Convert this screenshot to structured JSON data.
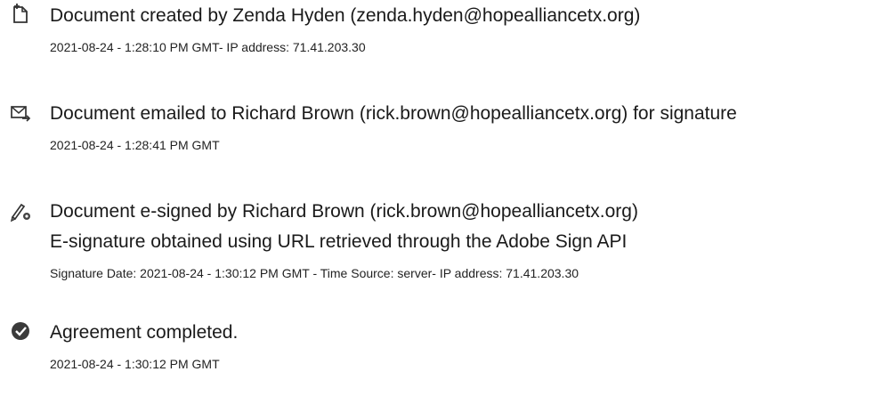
{
  "events": [
    {
      "icon": "document-created-icon",
      "title": "Document created by Zenda Hyden (zenda.hyden@hopealliancetx.org)",
      "detail": "2021-08-24 - 1:28:10 PM GMT- IP address: 71.41.203.30"
    },
    {
      "icon": "email-sent-icon",
      "title": "Document emailed to Richard Brown (rick.brown@hopealliancetx.org) for signature",
      "detail": "2021-08-24 - 1:28:41 PM GMT"
    },
    {
      "icon": "e-sign-pen-icon",
      "title": "Document e-signed by Richard Brown (rick.brown@hopealliancetx.org)",
      "title2": "E-signature obtained using URL retrieved through the Adobe Sign API",
      "detail": "Signature Date: 2021-08-24 - 1:30:12 PM GMT - Time Source: server- IP address: 71.41.203.30"
    },
    {
      "icon": "agreement-completed-icon",
      "title": "Agreement completed.",
      "detail": "2021-08-24 - 1:30:12 PM GMT"
    }
  ]
}
